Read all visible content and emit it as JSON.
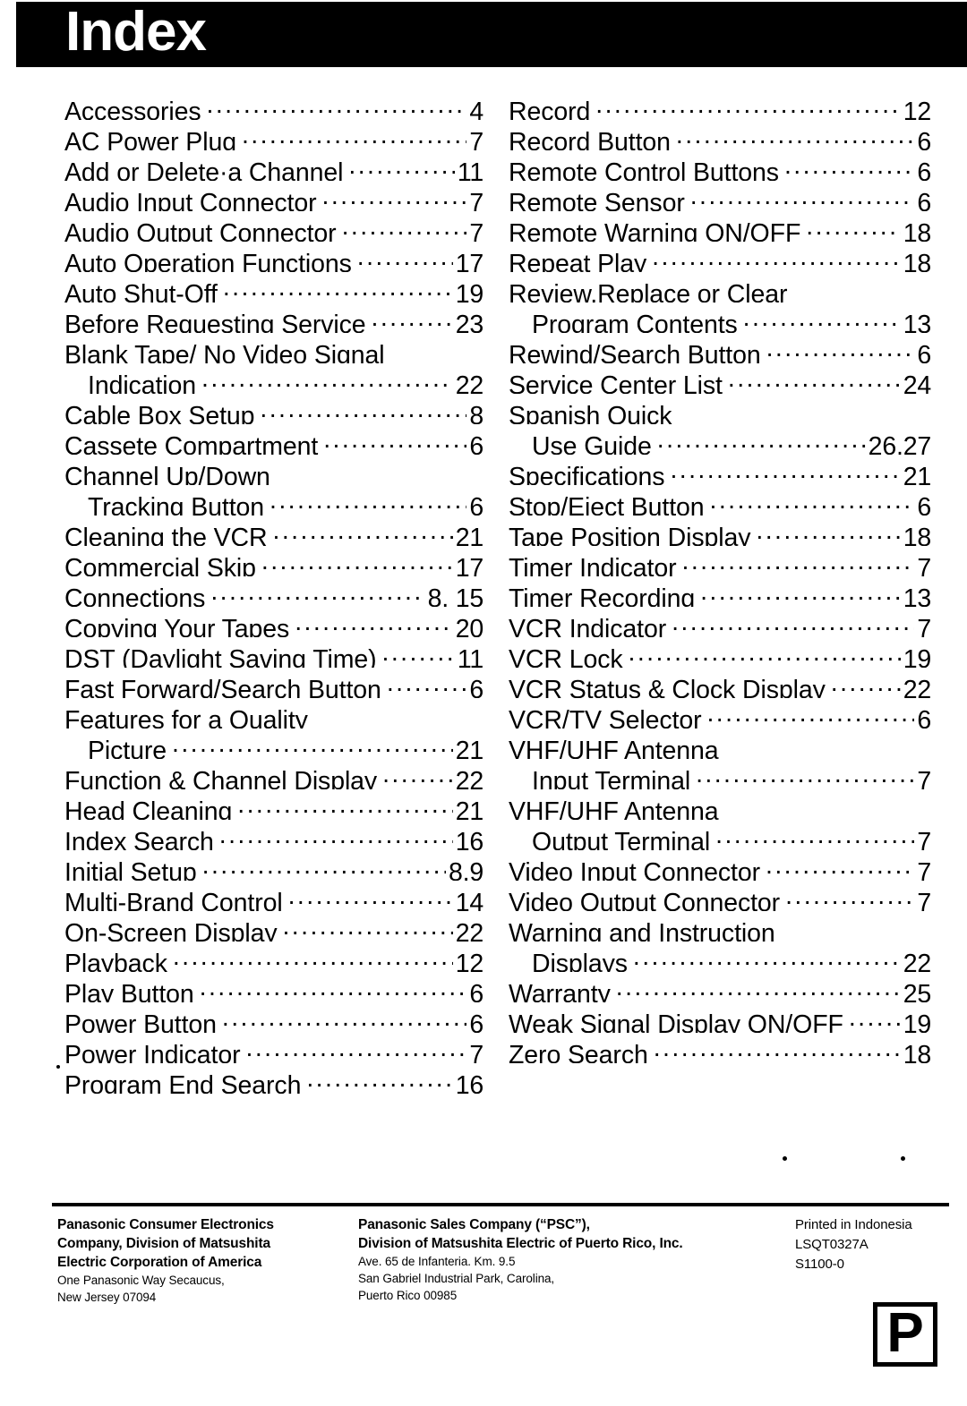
{
  "header": {
    "title": "Index"
  },
  "index": {
    "left_column": [
      {
        "label": "Accessories",
        "page": "4",
        "continuation": false,
        "leader": true
      },
      {
        "label": "AC Power Plug",
        "page": "7",
        "continuation": false,
        "leader": true
      },
      {
        "label": "Add or Delete·a Channel",
        "page": "11",
        "continuation": false,
        "leader": true
      },
      {
        "label": "Audio Input Connector",
        "page": "7",
        "continuation": false,
        "leader": true
      },
      {
        "label": "Audio Output Connector",
        "page": "7",
        "continuation": false,
        "leader": true
      },
      {
        "label": "Auto Operation Functions",
        "page": "17",
        "continuation": false,
        "leader": true
      },
      {
        "label": "Auto Shut-Off",
        "page": "19",
        "continuation": false,
        "leader": true
      },
      {
        "label": "Before Requesting Service",
        "page": "23",
        "continuation": false,
        "leader": true
      },
      {
        "label": "Blank Tape/ No Video Signal",
        "page": "",
        "continuation": false,
        "leader": false
      },
      {
        "label": "Indication",
        "page": "22",
        "continuation": true,
        "leader": true
      },
      {
        "label": "Cable Box Setup",
        "page": "8",
        "continuation": false,
        "leader": true
      },
      {
        "label": "Cassete Compartment",
        "page": "6",
        "continuation": false,
        "leader": true
      },
      {
        "label": "Channel Up/Down",
        "page": "",
        "continuation": false,
        "leader": false
      },
      {
        "label": "Tracking Button",
        "page": "6",
        "continuation": true,
        "leader": true
      },
      {
        "label": "Cleaning the VCR",
        "page": "21",
        "continuation": false,
        "leader": true
      },
      {
        "label": "Commercial Skip",
        "page": "17",
        "continuation": false,
        "leader": true
      },
      {
        "label": "Connections",
        "page": "8, 15",
        "continuation": false,
        "leader": true
      },
      {
        "label": "Copying Your Tapes",
        "page": "20",
        "continuation": false,
        "leader": true
      },
      {
        "label": "DST (Daylight Saving Time)",
        "page": "11",
        "continuation": false,
        "leader": true
      },
      {
        "label": "Fast Forward/Search Button",
        "page": "6",
        "continuation": false,
        "leader": true
      },
      {
        "label": "Features for a Quality",
        "page": "",
        "continuation": false,
        "leader": false
      },
      {
        "label": "Picture",
        "page": "21",
        "continuation": true,
        "leader": true
      },
      {
        "label": "Function & Channel Display",
        "page": "22",
        "continuation": false,
        "leader": true
      },
      {
        "label": "Head Cleaning",
        "page": "21",
        "continuation": false,
        "leader": true
      },
      {
        "label": "Index Search",
        "page": "16",
        "continuation": false,
        "leader": true
      },
      {
        "label": "Initial Setup",
        "page": "8,9",
        "continuation": false,
        "leader": true
      },
      {
        "label": "Multi-Brand Control",
        "page": "14",
        "continuation": false,
        "leader": true
      },
      {
        "label": "On-Screen Display",
        "page": "22",
        "continuation": false,
        "leader": true
      },
      {
        "label": "Playback",
        "page": "12",
        "continuation": false,
        "leader": true
      },
      {
        "label": "Play Button",
        "page": "6",
        "continuation": false,
        "leader": true
      },
      {
        "label": "Power Button",
        "page": "6",
        "continuation": false,
        "leader": true
      },
      {
        "label": "Power Indicator",
        "page": "7",
        "continuation": false,
        "leader": true
      },
      {
        "label": "Program End Search",
        "page": "16",
        "continuation": false,
        "leader": true
      }
    ],
    "right_column": [
      {
        "label": "Record",
        "page": "12",
        "continuation": false,
        "leader": true
      },
      {
        "label": "Record Button",
        "page": "6",
        "continuation": false,
        "leader": true
      },
      {
        "label": "Remote Control Buttons",
        "page": "6",
        "continuation": false,
        "leader": true
      },
      {
        "label": "Remote Sensor",
        "page": "6",
        "continuation": false,
        "leader": true
      },
      {
        "label": "Remote Warning ON/OFF",
        "page": "18",
        "continuation": false,
        "leader": true
      },
      {
        "label": "Repeat Play",
        "page": "18",
        "continuation": false,
        "leader": true
      },
      {
        "label": "Review,Replace or Clear",
        "page": "",
        "continuation": false,
        "leader": false
      },
      {
        "label": "Program Contents",
        "page": "13",
        "continuation": true,
        "leader": true
      },
      {
        "label": "Rewind/Search Button",
        "page": "6",
        "continuation": false,
        "leader": true
      },
      {
        "label": "Service Center List",
        "page": "24",
        "continuation": false,
        "leader": true
      },
      {
        "label": "Spanish Quick",
        "page": "",
        "continuation": false,
        "leader": false
      },
      {
        "label": "Use Guide",
        "page": "26,27",
        "continuation": true,
        "leader": true
      },
      {
        "label": "Specifications",
        "page": "21",
        "continuation": false,
        "leader": true
      },
      {
        "label": "Stop/Eject Button",
        "page": "6",
        "continuation": false,
        "leader": true
      },
      {
        "label": "Tape Position Display",
        "page": "18",
        "continuation": false,
        "leader": true
      },
      {
        "label": "Timer Indicator",
        "page": "7",
        "continuation": false,
        "leader": true
      },
      {
        "label": "Timer Recording",
        "page": "13",
        "continuation": false,
        "leader": true
      },
      {
        "label": "VCR Indicator",
        "page": "7",
        "continuation": false,
        "leader": true
      },
      {
        "label": "VCR Lock",
        "page": "19",
        "continuation": false,
        "leader": true
      },
      {
        "label": "VCR Status & Clock Display",
        "page": "22",
        "continuation": false,
        "leader": true
      },
      {
        "label": "VCR/TV Selector",
        "page": "6",
        "continuation": false,
        "leader": true
      },
      {
        "label": "VHF/UHF Antenna",
        "page": "",
        "continuation": false,
        "leader": false
      },
      {
        "label": "Input Terminal",
        "page": "7",
        "continuation": true,
        "leader": true
      },
      {
        "label": "VHF/UHF Antenna",
        "page": "",
        "continuation": false,
        "leader": false
      },
      {
        "label": "Output Terminal",
        "page": "7",
        "continuation": true,
        "leader": true
      },
      {
        "label": "Video Input Connector",
        "page": "7",
        "continuation": false,
        "leader": true
      },
      {
        "label": "Video Output Connector",
        "page": "7",
        "continuation": false,
        "leader": true
      },
      {
        "label": "Warning and Instruction",
        "page": "",
        "continuation": false,
        "leader": false
      },
      {
        "label": "Displays",
        "page": "22",
        "continuation": true,
        "leader": true
      },
      {
        "label": "Warranty",
        "page": "25",
        "continuation": false,
        "leader": true
      },
      {
        "label": "Weak Signal Display ON/OFF",
        "page": "19",
        "continuation": false,
        "leader": true
      },
      {
        "label": "Zero Search",
        "page": "18",
        "continuation": false,
        "leader": true
      }
    ]
  },
  "footer": {
    "column_1": {
      "bold_lines": [
        "Panasonic Consumer Electronics",
        "Company, Division of Matsushita",
        "Electric Corporation of America"
      ],
      "plain_lines": [
        "One Panasonic Way Secaucus,",
        "New Jersey 07094"
      ]
    },
    "column_2": {
      "bold_lines": [
        "Panasonic Sales Company (“PSC”),",
        "Division of Matsushita Electric of Puerto Rico, Inc."
      ],
      "plain_lines": [
        "Ave. 65 de Infanteria. Km. 9.5",
        "San Gabriel Industrial Park, Carolina,",
        "Puerto Rico 00985"
      ]
    },
    "column_3": {
      "lines": [
        "Printed in Indonesia",
        "LSQT0327A",
        "S1100-0"
      ]
    },
    "mark": "P"
  }
}
